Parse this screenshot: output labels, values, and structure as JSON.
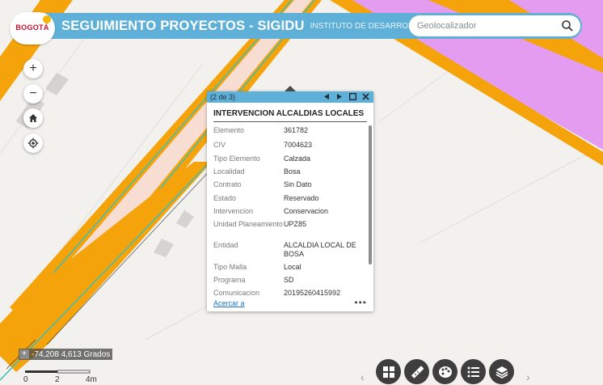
{
  "header": {
    "logo_text": "BOGOTÁ",
    "title": "SEGUIMIENTO PROYECTOS - SIGIDU",
    "subtitle": "INSTITUTO DE DESARROLLO URBANO",
    "search_placeholder": "Geolocalizador"
  },
  "map_controls": {
    "zoom_in": "+",
    "zoom_out": "−",
    "home_icon": "home-icon",
    "locate_icon": "locate-icon"
  },
  "popup": {
    "counter": "(2 de 3)",
    "heading": "INTERVENCION ALCALDIAS LOCALES",
    "rows": [
      {
        "key": "Elemento",
        "value": "361782"
      },
      {
        "key": "CIV",
        "value": "7004623"
      },
      {
        "key": "Tipo Elemento",
        "value": "Calzada"
      },
      {
        "key": "Localidad",
        "value": "Bosa"
      },
      {
        "key": "Contrato",
        "value": "Sin Dato"
      },
      {
        "key": "Estado",
        "value": "Reservado"
      },
      {
        "key": "Intervencion",
        "value": "Conservacion"
      },
      {
        "key": "Unidad Planeamiento",
        "value": "UPZ85"
      },
      {
        "key": "Entidad",
        "value": "ALCALDIA LOCAL DE BOSA"
      },
      {
        "key": "Tipo Malla",
        "value": "Local"
      },
      {
        "key": "Programa",
        "value": "SD"
      },
      {
        "key": "Comunicacion",
        "value": "20195260415992"
      }
    ],
    "zoom_link": "Acercar a",
    "more": "•••"
  },
  "coordinates": {
    "toggle": "+",
    "text": "-74,208 4,613 Grados"
  },
  "scale": {
    "labels": [
      "0",
      "2",
      "4m"
    ]
  },
  "toolbar": {
    "buttons": [
      "basemap-gallery-icon",
      "measure-icon",
      "layer-styles-icon",
      "legend-list-icon",
      "layers-icon"
    ],
    "prev": "‹",
    "next": "›"
  },
  "colors": {
    "header": "#5fb0d8",
    "road_orange": "#f5a30a",
    "road_fill": "#f8ddd3",
    "road_edge": "#3dbfb8",
    "district": "#e49cf0"
  }
}
